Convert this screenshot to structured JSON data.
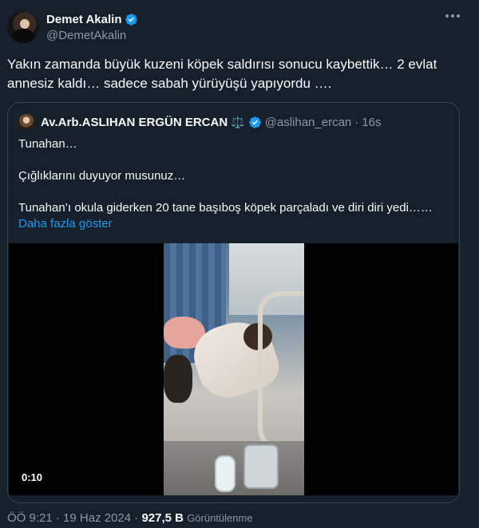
{
  "author": {
    "name": "Demet Akalin",
    "handle": "@DemetAkalin",
    "verified_color": "#1d9bf0"
  },
  "tweet": {
    "text_line1": "Yakın zamanda büyük kuzeni köpek saldırısı sonucu kaybettik… 2 evlat",
    "text_line2": "annesiz kaldı… sadece sabah yürüyüşü yapıyordu …."
  },
  "quote": {
    "name": "Av.Arb.ASLIHAN ERGÜN ERCAN",
    "emoji": "⚖️",
    "handle": "@aslihan_ercan",
    "separator": "·",
    "time": "16s",
    "lines": [
      "Tunahan…",
      "Çığlıklarını duyuyor musunuz…",
      "Tunahan’ı okula giderken 20 tane başıboş köpek parçaladı ve diri diri yedi……"
    ],
    "show_more": "Daha fazla göster",
    "video_duration": "0:10"
  },
  "footer": {
    "time": "ÖÖ 9:21",
    "separator": "·",
    "date": "19 Haz 2024",
    "views": "927,5 B",
    "views_label": "Görüntülenme"
  },
  "icons": {
    "more": "more-horizontal-icon",
    "verified": "verified-badge-icon"
  }
}
